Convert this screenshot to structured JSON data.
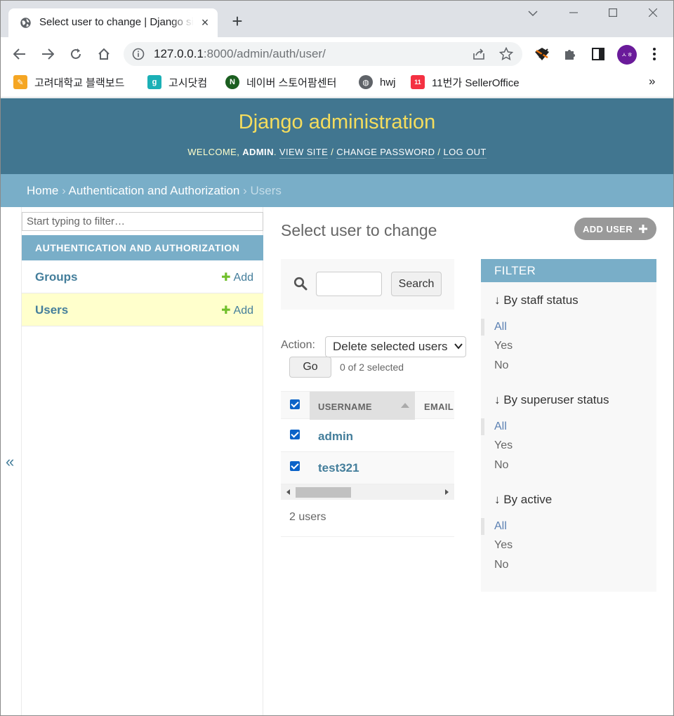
{
  "browser": {
    "tab_title": "Select user to change | Django site admin",
    "url_host": "127.0.0.1",
    "url_rest": ":8000/admin/auth/user/",
    "avatar_initials": "ㅅㅎ",
    "bookmarks": [
      {
        "label": "고려대학교 블랙보드",
        "icon_color": "#f5a623",
        "icon": "pencil-icon"
      },
      {
        "label": "고시닷컴",
        "icon_color": "#1bb0b6",
        "icon": "g-logo-icon"
      },
      {
        "label": "네이버 스토어팜센터",
        "icon_color": "#1b5e20",
        "icon": "naver-store-icon"
      },
      {
        "label": "hwj",
        "icon_color": "#5f6368",
        "icon": "globe-icon"
      },
      {
        "label": "11번가 SellerOffice",
        "icon_color": "#f43142",
        "icon": "11st-icon"
      }
    ],
    "bookmarks_more": "»"
  },
  "header": {
    "branding": "Django administration",
    "welcome": "WELCOME, ",
    "username": "ADMIN",
    "view_site": "VIEW SITE",
    "change_password": "CHANGE PASSWORD",
    "log_out": "LOG OUT"
  },
  "breadcrumbs": {
    "home": "Home",
    "app": "Authentication and Authorization",
    "current": "Users",
    "sep": " › "
  },
  "sidebar": {
    "filter_placeholder": "Start typing to filter…",
    "app_caption": "AUTHENTICATION AND AUTHORIZATION",
    "models": [
      {
        "name": "Groups",
        "add": "Add"
      },
      {
        "name": "Users",
        "add": "Add"
      }
    ],
    "collapse": "«"
  },
  "content": {
    "title": "Select user to change",
    "add_user": "ADD USER",
    "search_button": "Search",
    "action_label": "Action:",
    "action_selected": "Delete selected users",
    "go": "Go",
    "selected_count": "0 of 2 selected",
    "columns": [
      "USERNAME",
      "EMAIL"
    ],
    "rows": [
      {
        "username": "admin"
      },
      {
        "username": "test321"
      }
    ],
    "paginator": "2 users"
  },
  "filter": {
    "heading": "FILTER",
    "groups": [
      {
        "title": "↓ By staff status",
        "options": [
          "All",
          "Yes",
          "No"
        ]
      },
      {
        "title": "↓ By superuser status",
        "options": [
          "All",
          "Yes",
          "No"
        ]
      },
      {
        "title": "↓ By active",
        "options": [
          "All",
          "Yes",
          "No"
        ]
      }
    ]
  },
  "colors": {
    "header_bg": "#417690",
    "branding": "#f5dd5d",
    "module_bg": "#79aec8",
    "link": "#447e9b",
    "add_green": "#70bf2b",
    "current_row": "#ffffcc"
  }
}
